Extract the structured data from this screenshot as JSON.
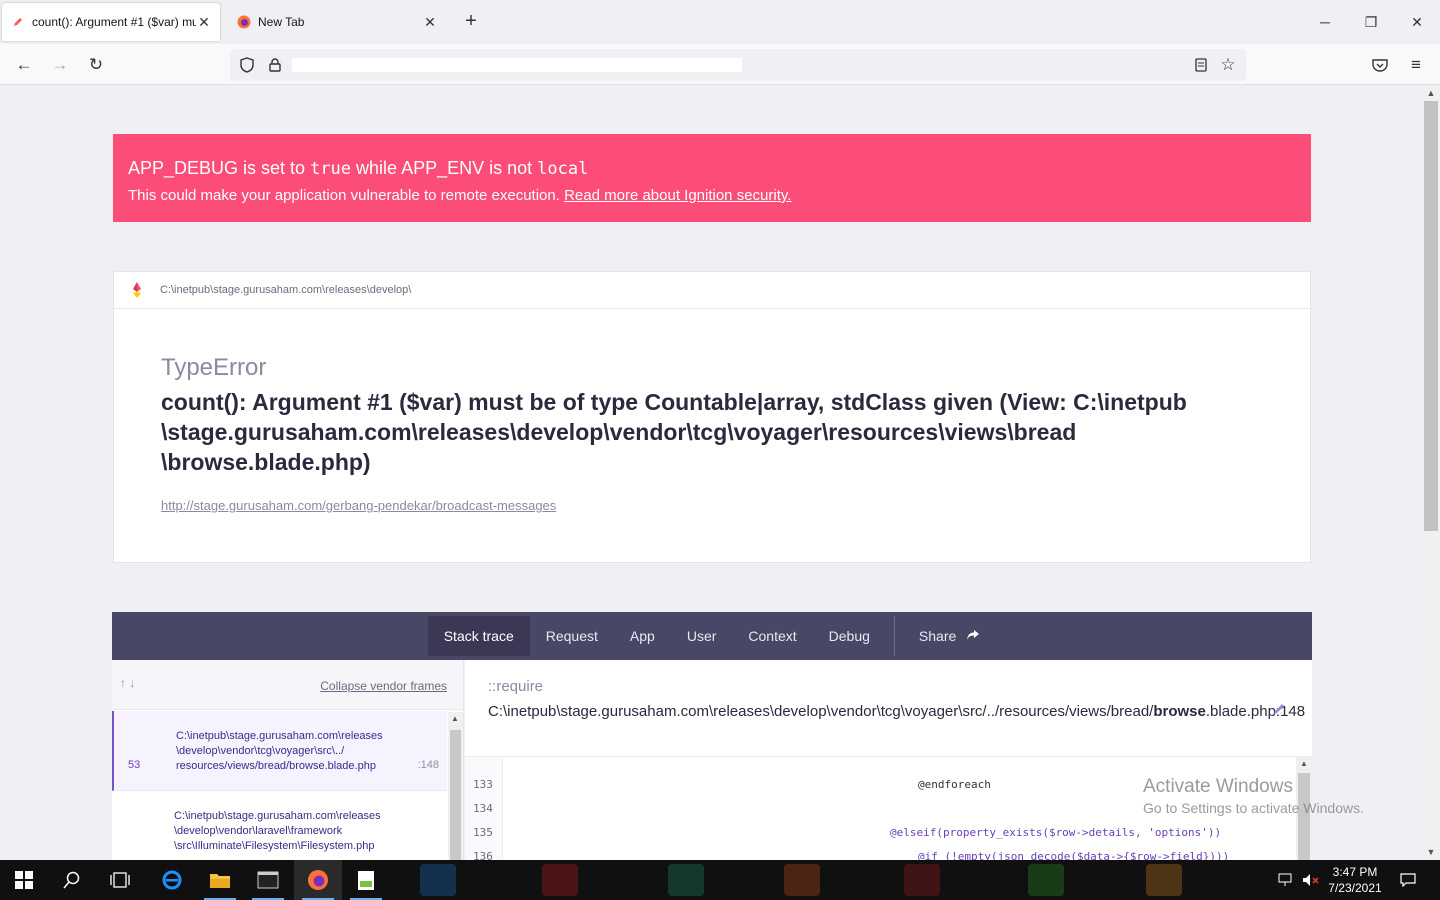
{
  "browser": {
    "tabs": [
      {
        "title": "count(): Argument #1 ($var) mus",
        "active": true
      },
      {
        "title": "New Tab",
        "active": false
      }
    ],
    "icons": {
      "back": "back-arrow-icon",
      "forward": "forward-arrow-icon",
      "reload": "reload-icon",
      "pocket": "pocket-icon",
      "menu": "hamburger-menu-icon"
    }
  },
  "alert": {
    "var1": "APP_DEBUG",
    "text1": " is set to ",
    "val1": "true",
    "text2": " while ",
    "var2": "APP_ENV",
    "text3": " is not ",
    "val2": "local",
    "line2": "This could make your application vulnerable to remote execution. ",
    "link": "Read more about Ignition security.",
    "color": "#fc4c78"
  },
  "error": {
    "path": "C:\\inetpub\\stage.gurusaham.com\\releases\\develop\\",
    "exception_class": "TypeError",
    "message": "count(): Argument #1 ($var) must be of type Countable|array, stdClass given (View: C:\\inetpub \\stage.gurusaham.com\\releases\\develop\\vendor\\tcg\\voyager\\resources\\views\\bread \\browse.blade.php)",
    "url": "http://stage.gurusaham.com/gerbang-pendekar/broadcast-messages"
  },
  "tabs": {
    "items": [
      "Stack trace",
      "Request",
      "App",
      "User",
      "Context",
      "Debug"
    ],
    "share": "Share",
    "bar_color": "#494766"
  },
  "frames": {
    "collapse": "Collapse vendor frames",
    "list": [
      {
        "num": "53",
        "text": "C:\\inetpub\\stage.gurusaham.com\\releases \\develop\\vendor\\tcg\\voyager\\src\\../ resources/views/bread/browse.blade.php",
        "line": ":148"
      },
      {
        "num": "",
        "text": "C:\\inetpub\\stage.gurusaham.com\\releases \\develop\\vendor\\laravel\\framework \\src\\Illuminate\\Filesystem\\Filesystem.php",
        "line": ""
      }
    ]
  },
  "detail": {
    "function": "::require",
    "path": "C:\\inetpub\\stage.gurusaham.com\\releases\\develop\\vendor\\tcg\\voyager\\src/../resources/views/bread/",
    "file": "browse",
    "file_rest": ".blade.php:148",
    "code": [
      {
        "ln": "133",
        "text": "@endforeach"
      },
      {
        "ln": "134",
        "text": ""
      },
      {
        "ln": "135",
        "text": "@elseif(property_exists($row->details, 'options'))"
      },
      {
        "ln": "136",
        "text": "@if (!empty(json_decode($data->{$row->field})))"
      }
    ]
  },
  "watermark": {
    "line1": "Activate Windows",
    "line2": "Go to Settings to activate Windows."
  },
  "taskbar": {
    "time": "3:47 PM",
    "date": "7/23/2021"
  }
}
